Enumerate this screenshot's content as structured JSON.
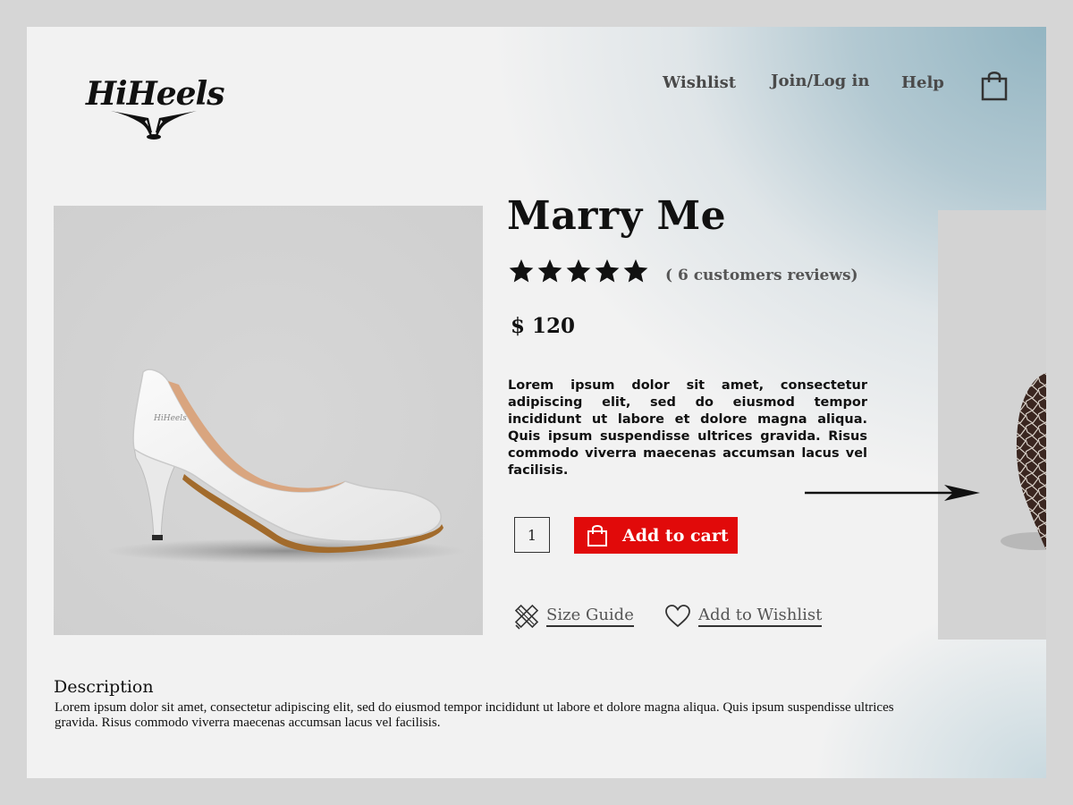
{
  "brand": {
    "name": "HiHeels"
  },
  "nav": {
    "items": [
      {
        "label": "Wishlist"
      },
      {
        "label": "Join/Log in"
      },
      {
        "label": "Help"
      }
    ],
    "cart_icon": "shopping-bag-icon"
  },
  "product": {
    "title": "Marry Me",
    "rating": 5,
    "rating_max": 5,
    "reviews": "( 6 customers reviews)",
    "price": "$ 120",
    "short_description": "Lorem ipsum dolor sit amet, consectetur adipiscing elit, sed do eiusmod tempor incididunt ut labore et dolore magna aliqua. Quis ipsum suspendisse ultrices gravida. Risus commodo viverra maecenas accumsan lacus vel facilisis.",
    "quantity": "1",
    "add_to_cart_label": "Add to cart",
    "size_guide_label": "Size Guide",
    "add_to_wishlist_label": "Add to Wishlist",
    "image_logo_text": "HiHeels"
  },
  "description": {
    "heading": "Description",
    "body": "Lorem ipsum dolor sit amet, consectetur adipiscing elit, sed do eiusmod tempor incididunt ut labore et dolore magna aliqua. Quis ipsum suspendisse ultrices gravida. Risus commodo viverra maecenas accumsan lacus vel facilisis."
  },
  "colors": {
    "accent_red": "#e10a0a",
    "gradient_blue": "#93b5c2",
    "background": "#f2f2f2"
  }
}
